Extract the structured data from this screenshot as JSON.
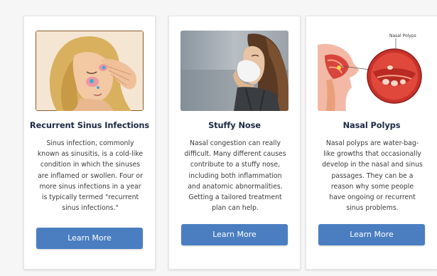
{
  "cards": [
    {
      "image": "woman-sinus-pain-illustration",
      "title": "Recurrent Sinus Infections",
      "description_lines": [
        "Sinus infection, commonly",
        "known as sinusitis, is a cold-like",
        "condition in which the sinuses",
        "are inflamed or swollen.  Four or",
        "more sinus infections in a year",
        "is typically termed \"recurrent",
        "sinus infections.\""
      ],
      "button_label": "Learn More"
    },
    {
      "image": "woman-blowing-nose-photo",
      "title": "Stuffy Nose",
      "description_lines": [
        "Nasal congestion can really",
        "difficult. Many different causes",
        "contribute to a stuffy nose,",
        "including both inflammation",
        "and anatomic abnormalities.",
        "Getting a tailored treatment",
        "plan can help."
      ],
      "button_label": "Learn More"
    },
    {
      "image": "nasal-polyps-diagram",
      "image_label": "Nasal Polyps",
      "title": "Nasal Polyps",
      "description_lines": [
        "Nasal polyps are water-bag-",
        "like growths that occasionally",
        "develop in the nasal and sinus",
        "passages. They can be a",
        "reason why some people",
        "have ongoing or recurrent",
        "sinus problems."
      ],
      "button_label": "Learn More"
    }
  ],
  "colors": {
    "button": "#4a7ec1",
    "title": "#1c2a43",
    "text": "#3a3a3a",
    "card_bg": "#ffffff",
    "page_bg": "#f6f6f6"
  }
}
